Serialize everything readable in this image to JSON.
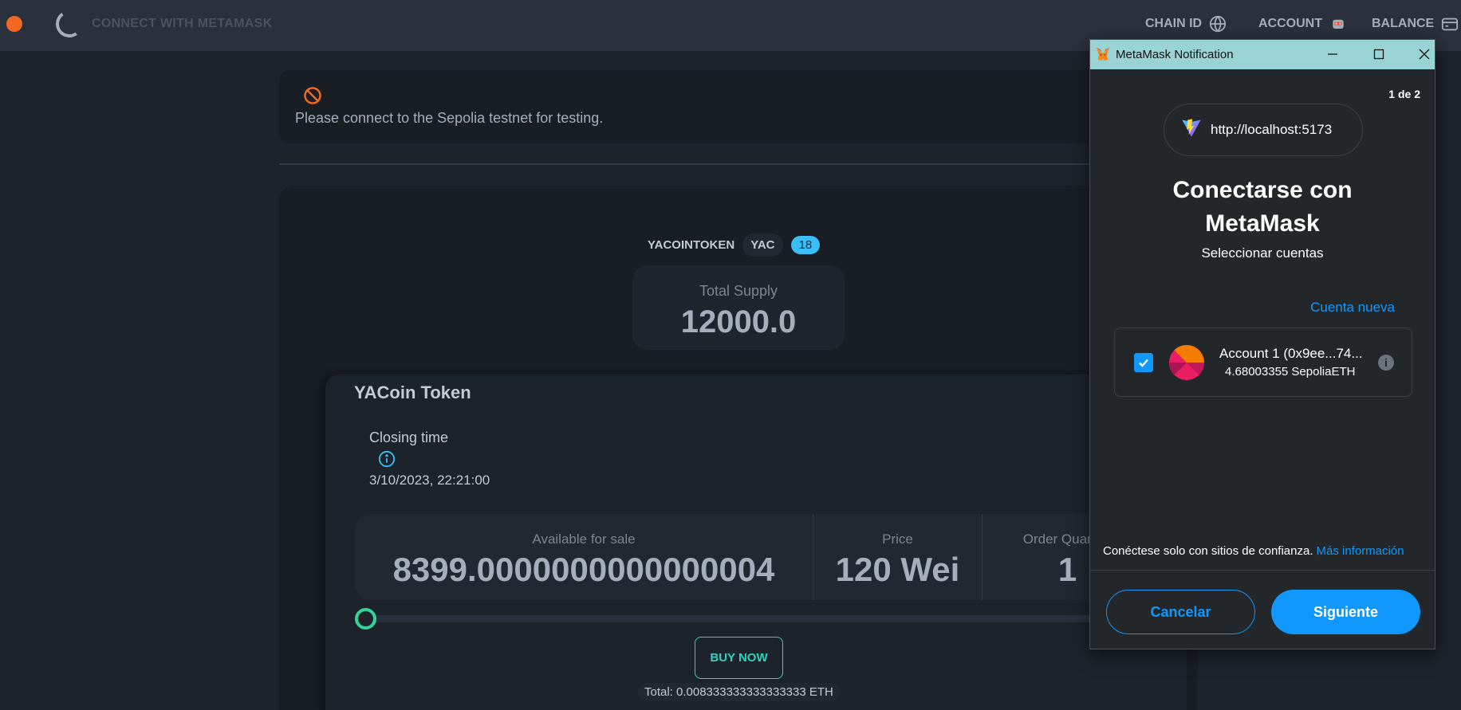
{
  "navbar": {
    "connect_label": "CONNECT WITH METAMASK",
    "chain_id_label": "CHAIN ID",
    "account_label": "ACCOUNT",
    "balance_label": "BALANCE"
  },
  "alert": {
    "message": "Please connect to the Sepolia testnet for testing."
  },
  "token": {
    "name_tag": "YACOINTOKEN",
    "symbol": "YAC",
    "decimals": "18",
    "total_supply_label": "Total Supply",
    "total_supply": "12000.0",
    "title": "YACoin Token",
    "closing_label": "Closing time",
    "closing_date": "3/10/2023, 22:21:00"
  },
  "stats": [
    {
      "label": "Available for sale",
      "value": "8399.0000000000000004"
    },
    {
      "label": "Price",
      "value": "120 Wei"
    },
    {
      "label": "Order Quantity",
      "value": "1"
    }
  ],
  "slider": {
    "level": 0
  },
  "buy": {
    "label": "BUY NOW",
    "total": "Total: 0.008333333333333333 ETH"
  },
  "metamask": {
    "window_title": "MetaMask Notification",
    "page": "1 de 2",
    "origin": "http://localhost:5173",
    "heading_line1": "Conectarse con",
    "heading_line2": "MetaMask",
    "subheading": "Seleccionar cuentas",
    "new_account": "Cuenta nueva",
    "account_name": "Account 1 (0x9ee...74...",
    "account_balance": "4.68003355 SepoliaETH",
    "trust_text": "Conéctese solo con sitios de confianza.",
    "more_info": "Más información",
    "cancel_label": "Cancelar",
    "next_label": "Siguiente"
  },
  "colors": {
    "accent": "#1098fc",
    "teal": "#2dd4bf",
    "orange": "#f26722"
  }
}
